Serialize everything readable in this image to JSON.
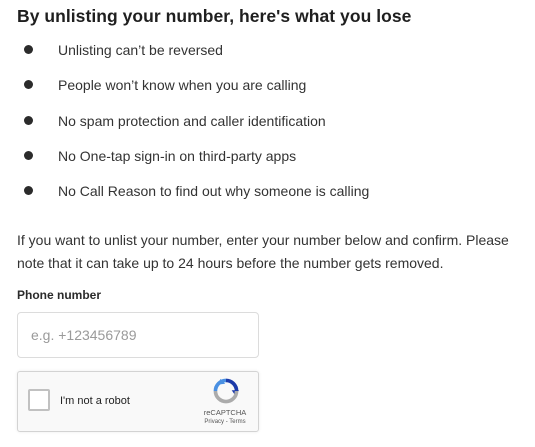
{
  "heading": "By unlisting your number, here's what you lose",
  "losses": [
    "Unlisting can’t be reversed",
    "People won’t know when you are calling",
    "No spam protection and caller identification",
    "No One-tap sign-in on third-party apps",
    "No Call Reason to find out why someone is calling"
  ],
  "instructions": "If you want to unlist your number, enter your number below and confirm. Please note that it can take up to 24 hours before the number gets removed.",
  "phone": {
    "label": "Phone number",
    "placeholder": "e.g. +123456789",
    "value": ""
  },
  "recaptcha": {
    "checkbox_label": "I'm not a robot",
    "checked": false,
    "brand": "reCAPTCHA",
    "privacy_link": "Privacy",
    "separator": " - ",
    "terms_link": "Terms",
    "logo_icon": "recaptcha-logo-icon"
  },
  "colors": {
    "text": "#333333",
    "bullet": "#2b2b2b",
    "input_border": "#dcdcdc",
    "recaptcha_bg": "#f9f9f9",
    "recaptcha_blue": "#1c3aa9",
    "recaptcha_light_blue": "#4a90e2",
    "recaptcha_gray": "#ababab"
  }
}
